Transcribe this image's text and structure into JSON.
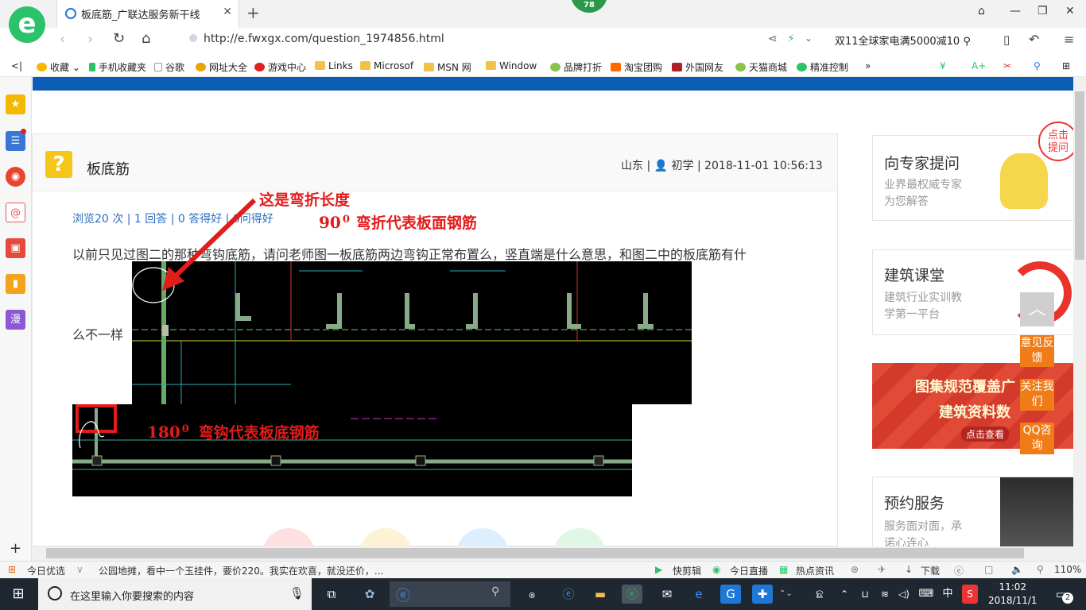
{
  "browser": {
    "badge": "78",
    "tab": {
      "title": "板底筋_广联达服务新干线"
    },
    "url": "http://e.fwxgx.com/question_1974856.html",
    "promo": "双11全球家电满5000减10",
    "bookmarks": [
      "收藏",
      "手机收藏夹",
      "谷歌",
      "网址大全",
      "游戏中心",
      "Links",
      "Microsof",
      "MSN 网",
      "Window",
      "品牌打折",
      "淘宝团购",
      "外国网友",
      "天猫商城",
      "精准控制"
    ]
  },
  "question": {
    "title": "板底筋",
    "meta": "山东 | 👤 初学 | 2018-11-01 10:56:13",
    "stats": "浏览20 次 | 1 回答 | 0 答得好 | 0问得好",
    "body_line1": "以前只见过图二的那种弯钩底筋，请问老师图一板底筋两边弯钩正常布置么，竖直端是什么意思，和图二中的板底筋有什",
    "body_line2": "么不一样"
  },
  "annotations": {
    "bend_length": "这是弯折长度",
    "bend90_num": "90",
    "bend90_sup": "0",
    "bend90_text": "弯折代表板面钢筋",
    "hook180_num": "180",
    "hook180_sup": "0",
    "hook180_text": "弯钩代表板底钢筋"
  },
  "right": {
    "expert": {
      "title": "向专家提问",
      "sub1": "业界最权威专家",
      "sub2": "为您解答",
      "bubble": "点击\n提问"
    },
    "school": {
      "title": "建筑课堂",
      "sub1": "建筑行业实训教",
      "sub2": "学第一平台"
    },
    "banner": {
      "line1": "图集规范覆盖广",
      "line2": "建筑资料数",
      "button": "点击查看"
    },
    "booking": {
      "title": "预约服务",
      "sub1": "服务面对面，承",
      "sub2": "诺心连心"
    }
  },
  "float_buttons": {
    "feedback": "意见反馈",
    "follow": "关注我们",
    "qq": "QQ咨询"
  },
  "status_bar": {
    "today": "今日优选",
    "news": "公园地摊，看中一个玉挂件，要价220。我实在欢喜，就没还价，...",
    "clip": "快剪辑",
    "live": "今日直播",
    "hot": "热点资讯",
    "download": "下载",
    "zoom": "110%"
  },
  "taskbar": {
    "search_placeholder": "在这里输入你要搜索的内容",
    "ime": "中",
    "time": "11:02",
    "date": "2018/11/1",
    "notifications": "2"
  },
  "colors": {
    "accent_blue": "#0b5eb4",
    "orange": "#f07c18",
    "annotation_red": "#e21b1b",
    "logo_green": "#2cc26a"
  }
}
